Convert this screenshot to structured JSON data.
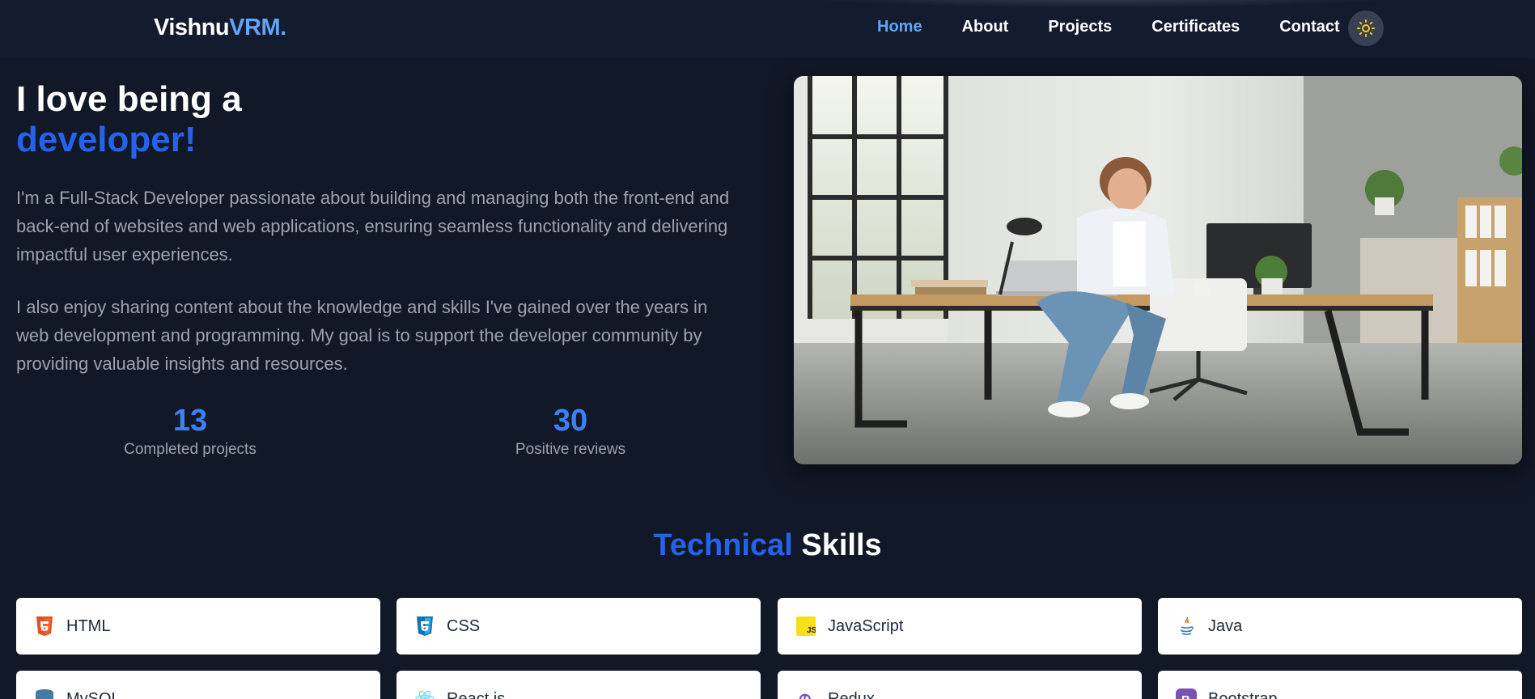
{
  "nav": {
    "logo_main": "Vishnu",
    "logo_accent": "VRM.",
    "links": [
      "Home",
      "About",
      "Projects",
      "Certificates",
      "Contact"
    ],
    "active": "Home"
  },
  "hero": {
    "title_line1": "I love being a",
    "title_line2": "developer!",
    "para1": "I'm a Full-Stack Developer passionate about building and managing both the front-end and back-end of websites and web applications, ensuring seamless functionality and delivering impactful user experiences.",
    "para2": "I also enjoy sharing content about the knowledge and skills I've gained over the years in web development and programming. My goal is to support the developer community by providing valuable insights and resources.",
    "stats": [
      {
        "value": "13",
        "label": "Completed projects"
      },
      {
        "value": "30",
        "label": "Positive reviews"
      }
    ]
  },
  "skills": {
    "title_accent": "Technical",
    "title_rest": "Skills",
    "items": [
      {
        "name": "HTML",
        "icon": "html5-icon",
        "color": "#e34f26"
      },
      {
        "name": "CSS",
        "icon": "css3-icon",
        "color": "#1572b6"
      },
      {
        "name": "JavaScript",
        "icon": "javascript-icon",
        "color": "#f7df1e"
      },
      {
        "name": "Java",
        "icon": "java-icon",
        "color": "#3a75b0"
      },
      {
        "name": "MySQL",
        "icon": "database-icon",
        "color": "#4479a1"
      },
      {
        "name": "React.js",
        "icon": "react-icon",
        "color": "#61dafb"
      },
      {
        "name": "Redux",
        "icon": "redux-icon",
        "color": "#764abc"
      },
      {
        "name": "Bootstrap",
        "icon": "bootstrap-icon",
        "color": "#7952b3"
      }
    ]
  },
  "colors": {
    "background": "#111827",
    "accent": "#2563eb",
    "link_active": "#60a5fa",
    "muted_text": "#9ca3af"
  }
}
